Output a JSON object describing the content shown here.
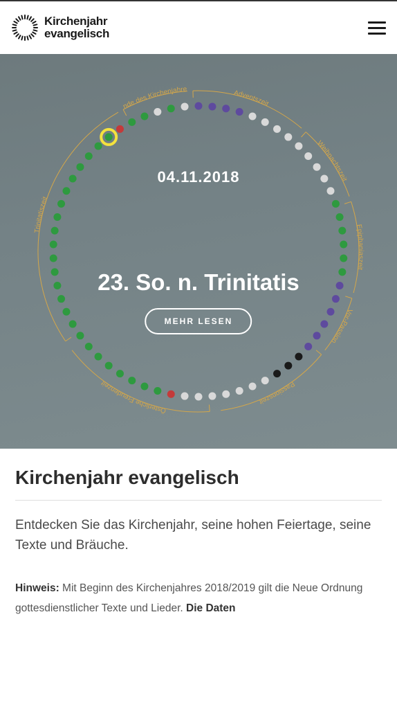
{
  "header": {
    "logo_line1": "Kirchenjahr",
    "logo_line2": "evangelisch"
  },
  "hero": {
    "date": "04.11.2018",
    "title": "23. So. n. Trinitatis",
    "more_label": "MEHR LESEN",
    "seasons": [
      "Adventszeit",
      "Weihnachtszeit",
      "Epiphaniaszeit",
      "Vor-Passion",
      "Passionszeit",
      "Österliche Freudenzeit",
      "Trinitatiszeit",
      "Ende des Kirchenjahres"
    ],
    "ring_colors": {
      "accent": "#d4a74a",
      "highlight_ring": "#f4e23d",
      "dots": {
        "purple": "#5e4a9e",
        "white": "#d9d9d9",
        "green": "#2e9a3f",
        "red": "#c43a3a",
        "black": "#1a1a1a"
      }
    },
    "dots": [
      {
        "c": "purple"
      },
      {
        "c": "purple"
      },
      {
        "c": "purple"
      },
      {
        "c": "purple"
      },
      {
        "c": "white"
      },
      {
        "c": "white"
      },
      {
        "c": "white"
      },
      {
        "c": "white"
      },
      {
        "c": "white"
      },
      {
        "c": "white"
      },
      {
        "c": "white"
      },
      {
        "c": "white"
      },
      {
        "c": "white"
      },
      {
        "c": "green"
      },
      {
        "c": "green"
      },
      {
        "c": "green"
      },
      {
        "c": "green"
      },
      {
        "c": "green"
      },
      {
        "c": "green"
      },
      {
        "c": "purple"
      },
      {
        "c": "purple"
      },
      {
        "c": "purple"
      },
      {
        "c": "purple"
      },
      {
        "c": "purple"
      },
      {
        "c": "purple"
      },
      {
        "c": "black"
      },
      {
        "c": "black"
      },
      {
        "c": "black"
      },
      {
        "c": "white"
      },
      {
        "c": "white"
      },
      {
        "c": "white"
      },
      {
        "c": "white"
      },
      {
        "c": "white"
      },
      {
        "c": "white"
      },
      {
        "c": "white"
      },
      {
        "c": "red"
      },
      {
        "c": "green"
      },
      {
        "c": "green"
      },
      {
        "c": "green"
      },
      {
        "c": "green"
      },
      {
        "c": "green"
      },
      {
        "c": "green"
      },
      {
        "c": "green"
      },
      {
        "c": "green"
      },
      {
        "c": "green"
      },
      {
        "c": "green"
      },
      {
        "c": "green"
      },
      {
        "c": "green"
      },
      {
        "c": "green"
      },
      {
        "c": "green"
      },
      {
        "c": "green"
      },
      {
        "c": "green"
      },
      {
        "c": "green"
      },
      {
        "c": "green"
      },
      {
        "c": "green"
      },
      {
        "c": "green"
      },
      {
        "c": "green"
      },
      {
        "c": "green"
      },
      {
        "c": "green"
      },
      {
        "c": "green",
        "highlight": true
      },
      {
        "c": "red"
      },
      {
        "c": "green"
      },
      {
        "c": "green"
      },
      {
        "c": "white"
      },
      {
        "c": "green"
      },
      {
        "c": "white"
      }
    ]
  },
  "content": {
    "heading": "Kirchenjahr evangelisch",
    "intro": "Entdecken Sie das Kirchenjahr, seine hohen Feiertage, seine Texte und Bräuche.",
    "note_label": "Hinweis:",
    "note_body": " Mit Beginn des Kirchenjahres 2018/2019 gilt die Neue Ordnung gottesdienstlicher Texte und Lieder. ",
    "note_bold_tail": "Die Daten"
  }
}
